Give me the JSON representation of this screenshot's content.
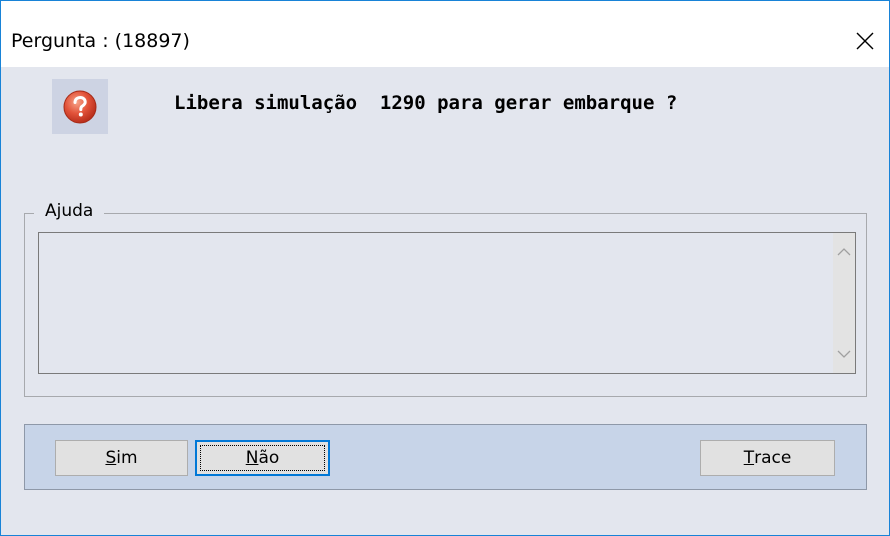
{
  "window": {
    "title": "Pergunta : (18897)",
    "close_icon": "close-icon"
  },
  "question": {
    "icon": "question-icon",
    "text": "Libera simulação  1290 para gerar embarque ?"
  },
  "help": {
    "legend": "Ajuda",
    "text": ""
  },
  "buttons": {
    "sim": {
      "accel": "S",
      "rest": "im"
    },
    "nao": {
      "accel": "N",
      "rest": "ão"
    },
    "trace": {
      "accel": "T",
      "rest": "race"
    }
  },
  "colors": {
    "window_border": "#1883d7",
    "client_bg": "#e3e6ee",
    "button_panel_bg": "#c7d4e8",
    "focus_border": "#0078d7",
    "question_icon": "#e2533a"
  }
}
